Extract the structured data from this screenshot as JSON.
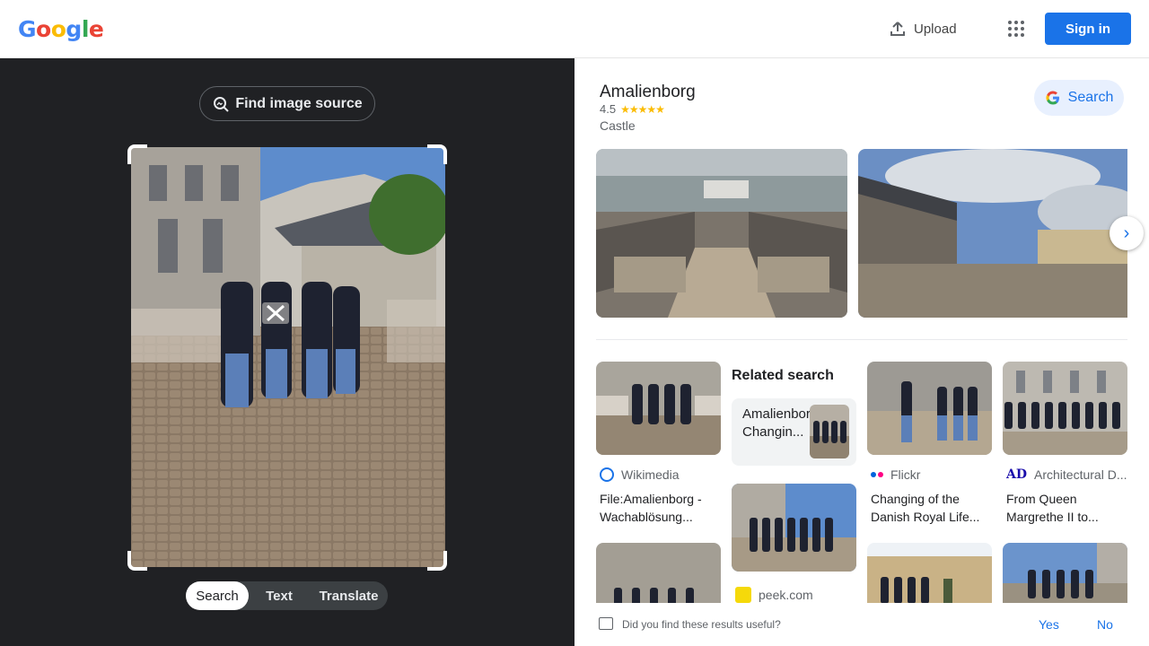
{
  "header": {
    "logo_letters": [
      {
        "ch": "G",
        "color": "#4285F4"
      },
      {
        "ch": "o",
        "color": "#EA4335"
      },
      {
        "ch": "o",
        "color": "#FBBC05"
      },
      {
        "ch": "g",
        "color": "#4285F4"
      },
      {
        "ch": "l",
        "color": "#34A853"
      },
      {
        "ch": "e",
        "color": "#EA4335"
      }
    ],
    "upload_label": "Upload",
    "upload_icon": "upload-icon",
    "apps_icon": "apps-grid-icon",
    "signin_label": "Sign in"
  },
  "lens": {
    "find_source_label": "Find image source",
    "find_source_icon": "image-search-icon",
    "tabs": [
      {
        "label": "Search",
        "active": true
      },
      {
        "label": "Text",
        "active": false
      },
      {
        "label": "Translate",
        "active": false
      }
    ]
  },
  "knowledge_panel": {
    "title": "Amalienborg",
    "rating": "4.5",
    "stars": "★★★★★",
    "type": "Castle",
    "search_label": "Search"
  },
  "related": {
    "title": "Related search",
    "chip_label": "Amalienborg Changin..."
  },
  "results": [
    {
      "source": "Wikimedia",
      "source_color": "#1a73e8",
      "title": "File:Amalienborg - Wachablösung..."
    },
    {
      "source": "Flickr",
      "source_color": "#ff0084",
      "title": "Changing of the Danish Royal Life..."
    },
    {
      "source": "Architectural D...",
      "source_color": "#1a0dab",
      "title": "From Queen Margrethe II to..."
    },
    {
      "source": "peek.com",
      "source_color": "#f5c518",
      "title": ""
    }
  ],
  "feedback": {
    "question": "Did you find these results useful?",
    "yes": "Yes",
    "no": "No"
  },
  "colors": {
    "accent": "#1a73e8",
    "dark_bg": "#202124"
  }
}
